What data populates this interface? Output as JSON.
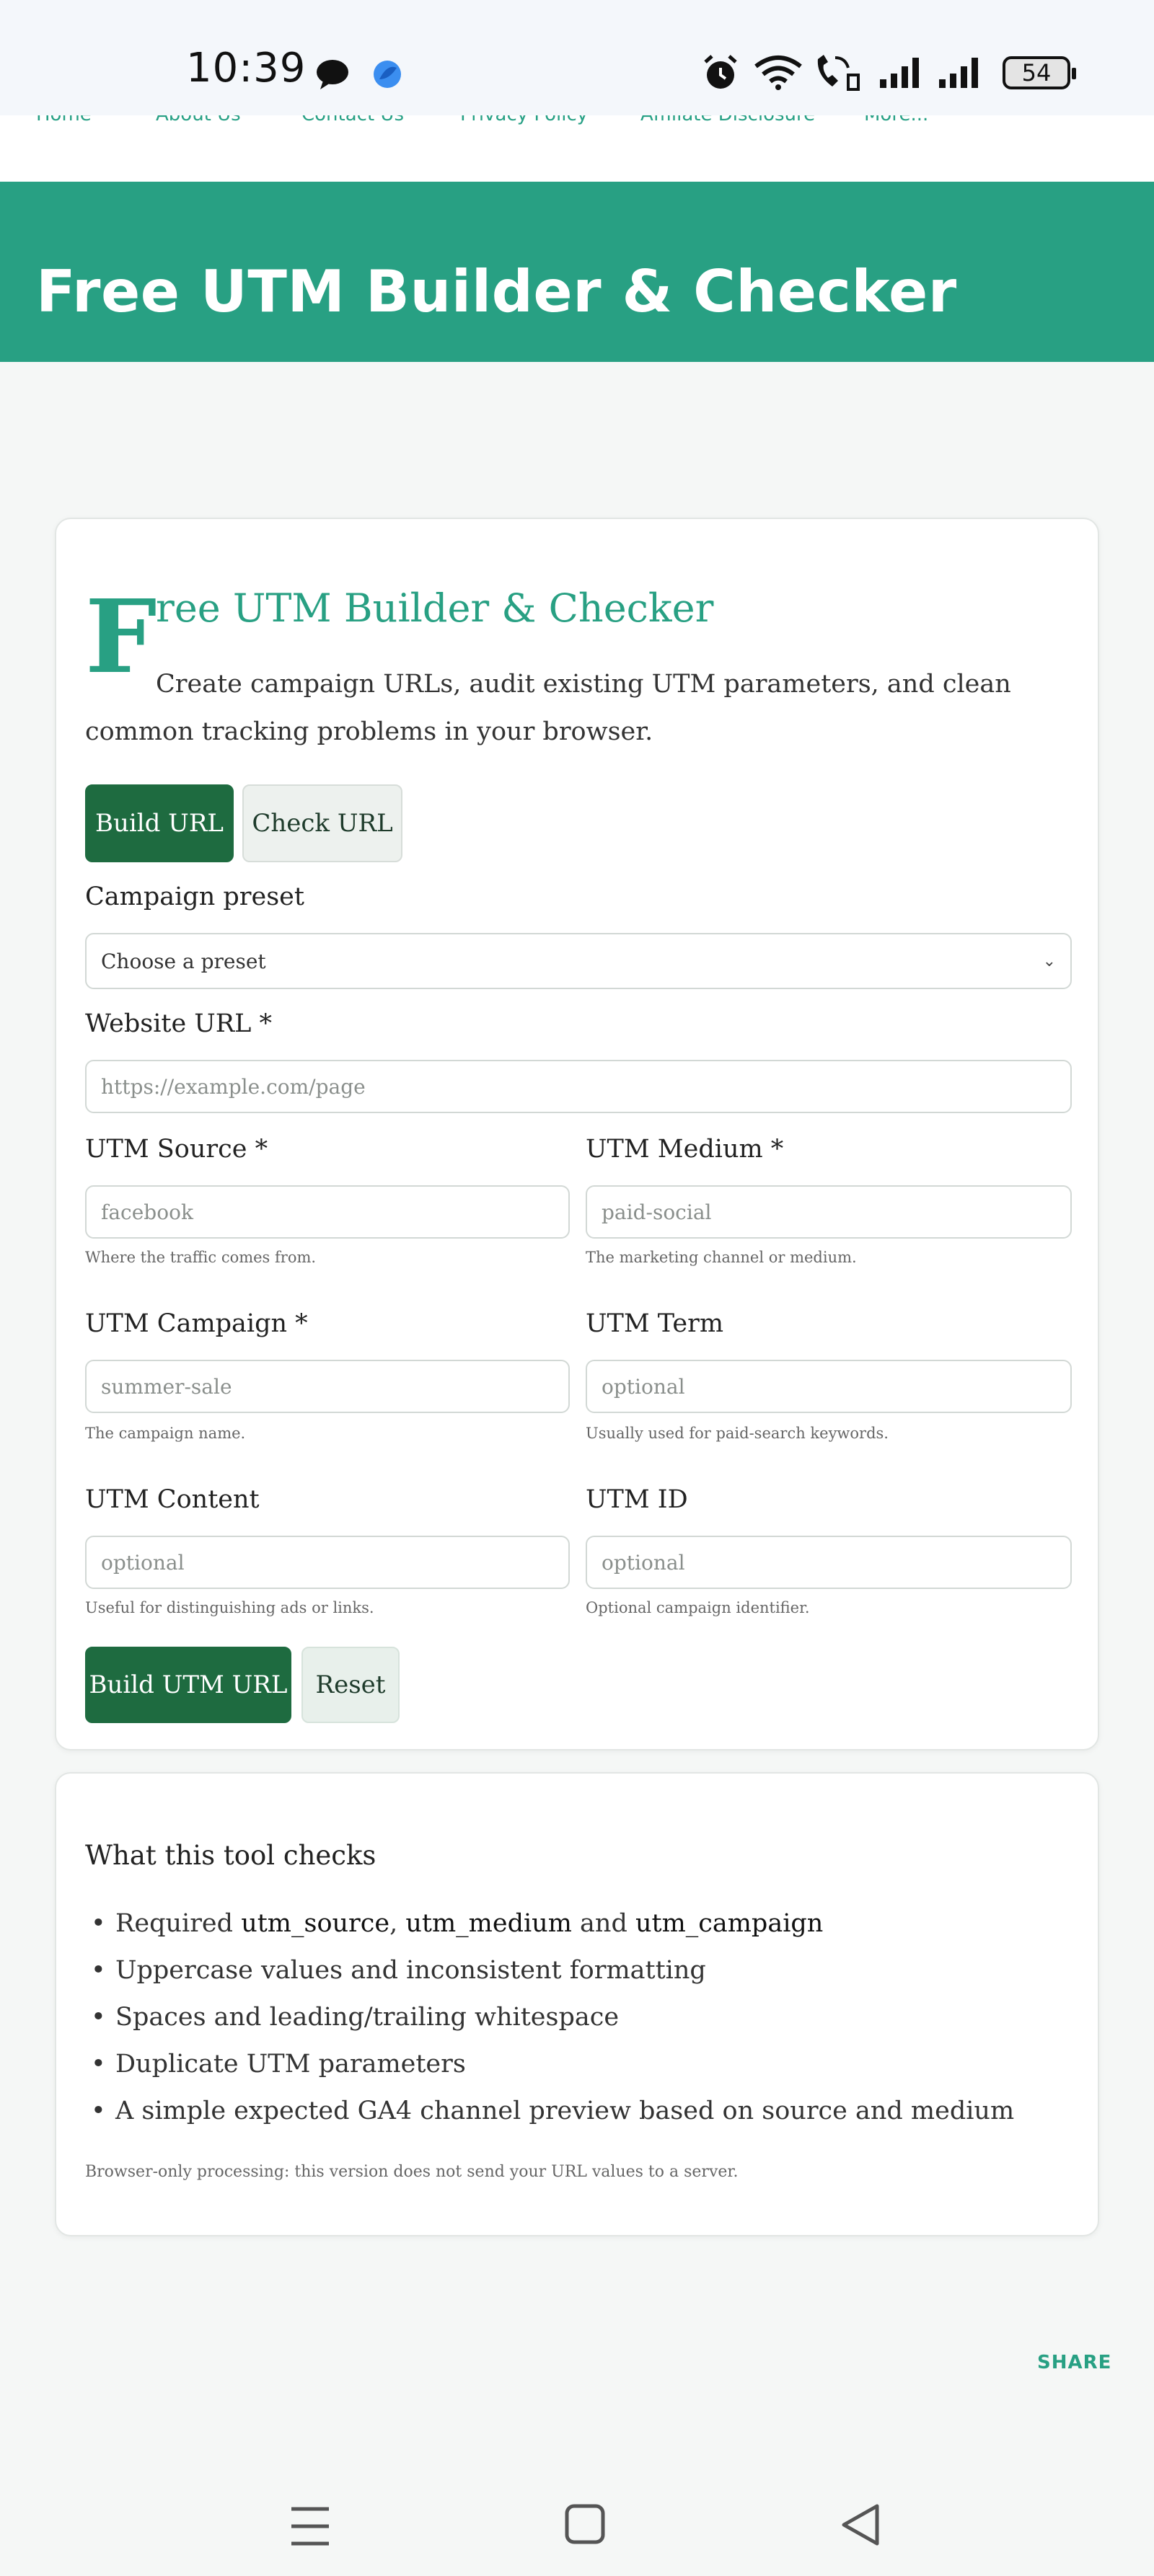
{
  "status_bar": {
    "time": "10:39",
    "battery": "54",
    "icons": [
      "chat-bubble-icon",
      "app-icon",
      "alarm-icon",
      "wifi-icon",
      "wifi-calling-icon",
      "signal-icon",
      "signal-icon"
    ]
  },
  "top_nav": {
    "items": [
      "Home",
      "About Us",
      "Contact Us",
      "Privacy Policy",
      "Affiliate Disclosure",
      "More..."
    ]
  },
  "hero": {
    "title": "Free UTM Builder & Checker"
  },
  "tool": {
    "dropcap": "F",
    "title_rest": "ree UTM Builder & Checker",
    "intro": "Create campaign URLs, audit existing UTM parameters, and clean common tracking problems in your browser.",
    "tabs": {
      "build": "Build URL",
      "check": "Check URL"
    },
    "preset": {
      "label": "Campaign preset",
      "value": "Choose a preset"
    },
    "website": {
      "label": "Website URL *",
      "placeholder": "https://example.com/page"
    },
    "source": {
      "label": "UTM Source *",
      "placeholder": "facebook",
      "hint": "Where the traffic comes from."
    },
    "medium": {
      "label": "UTM Medium *",
      "placeholder": "paid-social",
      "hint": "The marketing channel or medium."
    },
    "campaign": {
      "label": "UTM Campaign *",
      "placeholder": "summer-sale",
      "hint": "The campaign name."
    },
    "term": {
      "label": "UTM Term",
      "placeholder": "optional",
      "hint": "Usually used for paid-search keywords."
    },
    "content": {
      "label": "UTM Content",
      "placeholder": "optional",
      "hint": "Useful for distinguishing ads or links."
    },
    "id": {
      "label": "UTM ID",
      "placeholder": "optional",
      "hint": "Optional campaign identifier."
    },
    "build_button": "Build UTM URL",
    "reset_button": "Reset"
  },
  "checks": {
    "title": "What this tool checks",
    "item1": {
      "prefix": "Required ",
      "p1": "utm_source",
      "sep1": ", ",
      "p2": "utm_medium",
      "sep2": " and ",
      "p3": "utm_campaign"
    },
    "item2": "Uppercase values and inconsistent formatting",
    "item3": "Spaces and leading/trailing whitespace",
    "item4": "Duplicate UTM parameters",
    "item5": "A simple expected GA4 channel preview based on source and medium",
    "footnote": "Browser-only processing: this version does not send your URL values to a server."
  },
  "share": "SHARE",
  "colors": {
    "brand": "#28a083",
    "button": "#1e6b40"
  }
}
